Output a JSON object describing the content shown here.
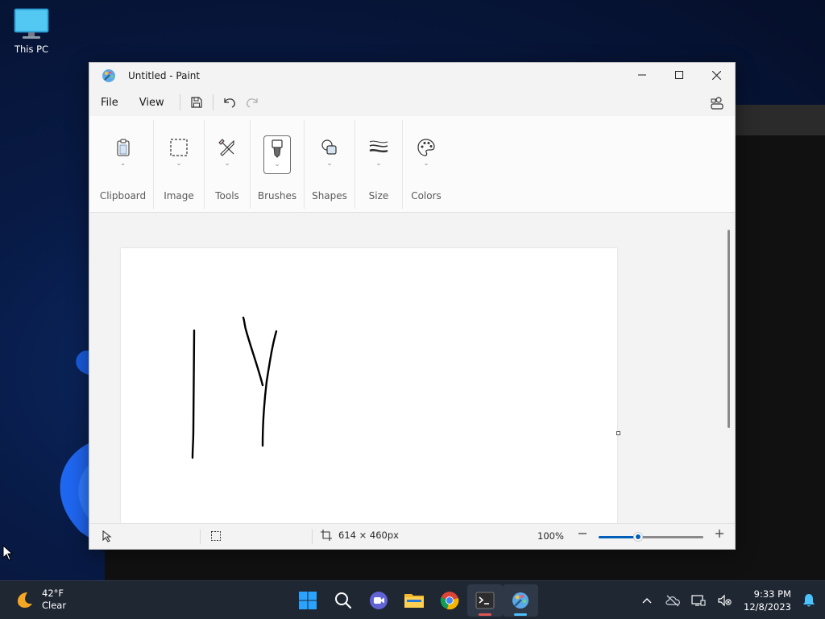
{
  "desktop": {
    "icons": [
      {
        "label": "This PC",
        "icon": "this-pc-icon"
      }
    ]
  },
  "window": {
    "title": "Untitled - Paint",
    "controls": [
      "minimize-icon",
      "maximize-icon",
      "close-icon"
    ]
  },
  "menubar": {
    "file": "File",
    "view": "View",
    "buttons": [
      "save-icon",
      "undo-icon",
      "redo-icon"
    ]
  },
  "ribbon": {
    "groups": [
      {
        "label": "Clipboard",
        "icon": "clipboard-icon"
      },
      {
        "label": "Image",
        "icon": "selection-icon"
      },
      {
        "label": "Tools",
        "icon": "tools-icon"
      },
      {
        "label": "Brushes",
        "icon": "brush-icon",
        "active": true
      },
      {
        "label": "Shapes",
        "icon": "shapes-icon"
      },
      {
        "label": "Size",
        "icon": "size-icon"
      },
      {
        "label": "Colors",
        "icon": "palette-icon"
      }
    ]
  },
  "canvas": {
    "stroke_color": "#000000",
    "background": "#ffffff"
  },
  "statusbar": {
    "canvas_size": "614 × 460px",
    "zoom": "100%",
    "zoom_fraction": 0.38
  },
  "taskbar": {
    "weather": {
      "temp": "42°F",
      "condition": "Clear"
    },
    "apps": [
      "start-icon",
      "search-icon",
      "meet-icon",
      "file-explorer-icon",
      "chrome-icon",
      "terminal-icon",
      "paint-icon"
    ],
    "clock": {
      "time": "9:33 PM",
      "date": "12/8/2023"
    }
  },
  "colors": {
    "accent": "#005fb8",
    "taskbar": "#1f2733"
  }
}
